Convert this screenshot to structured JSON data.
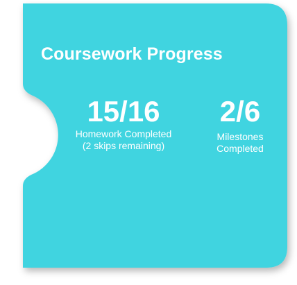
{
  "card": {
    "title": "Coursework Progress",
    "background_color": "#40d4e0",
    "text_color": "#ffffff"
  },
  "stats": {
    "homework": {
      "value": "15/16",
      "label_line1": "Homework Completed",
      "label_line2": "(2 skips remaining)"
    },
    "milestones": {
      "value": "2/6",
      "label_line1": "Milestones",
      "label_line2": "Completed"
    }
  }
}
